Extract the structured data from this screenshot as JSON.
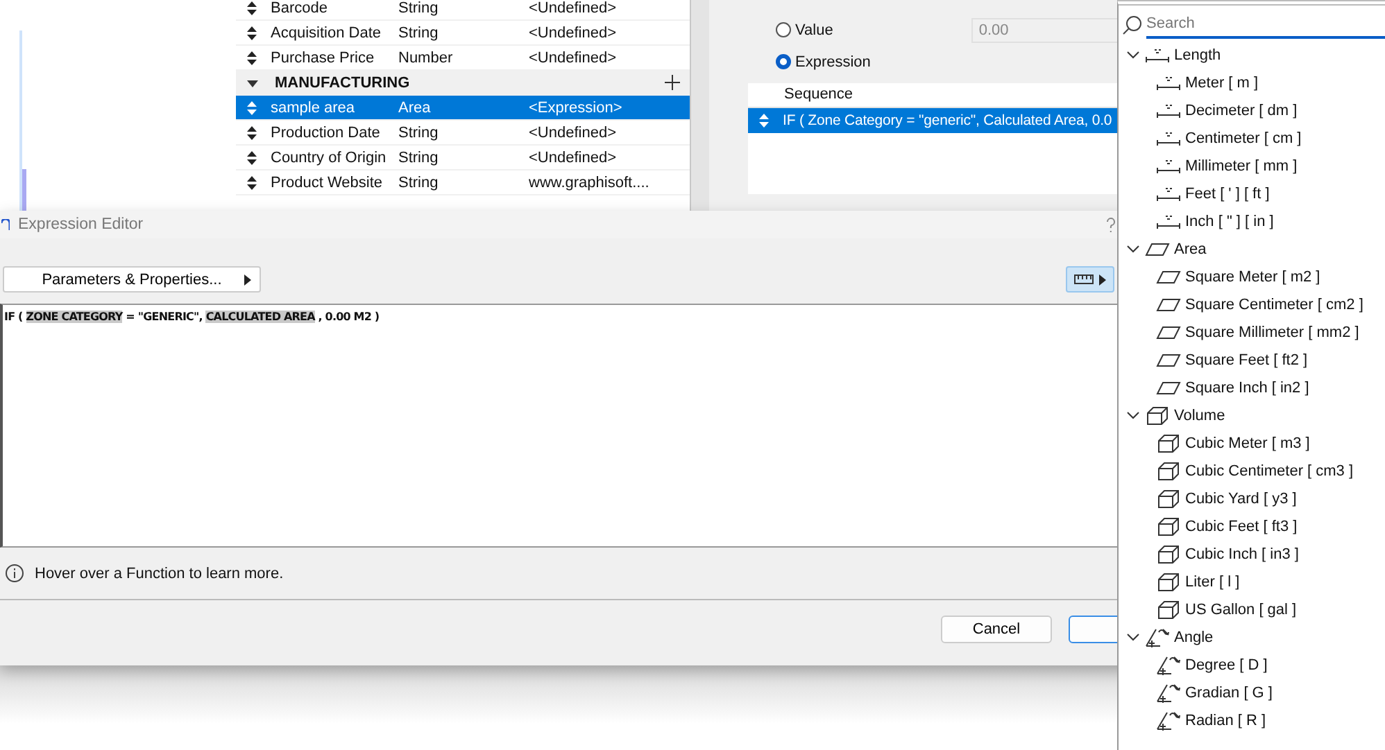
{
  "properties_table": {
    "rows": [
      {
        "kind": "property",
        "name": "Barcode",
        "type": "String",
        "value": "<Undefined>",
        "selected": false
      },
      {
        "kind": "property",
        "name": "Acquisition Date",
        "type": "String",
        "value": "<Undefined>",
        "selected": false
      },
      {
        "kind": "property",
        "name": "Purchase Price",
        "type": "Number",
        "value": "<Undefined>",
        "selected": false
      },
      {
        "kind": "group",
        "name": "MANUFACTURING",
        "expanded": true
      },
      {
        "kind": "property",
        "name": "sample area",
        "type": "Area",
        "value": "<Expression>",
        "selected": true
      },
      {
        "kind": "property",
        "name": "Production Date",
        "type": "String",
        "value": "<Undefined>",
        "selected": false
      },
      {
        "kind": "property",
        "name": "Country of Origin",
        "type": "String",
        "value": "<Undefined>",
        "selected": false
      },
      {
        "kind": "property",
        "name": "Product Website",
        "type": "String",
        "value": "www.graphisoft....",
        "selected": false
      }
    ]
  },
  "value_panel": {
    "options": [
      {
        "label": "Value",
        "selected": false,
        "value": "0.00",
        "disabled": true
      },
      {
        "label": "Expression",
        "selected": true
      }
    ],
    "sequence": {
      "header": "Sequence",
      "rows": [
        {
          "text": "IF ( Zone Category = \"generic\", Calculated Area, 0.0",
          "selected": true
        }
      ]
    }
  },
  "dialog": {
    "title": "Expression Editor",
    "parameters_button": "Parameters & Properties...",
    "expression": [
      {
        "kind": "text",
        "text": "IF ("
      },
      {
        "kind": "param",
        "text": "ZONE CATEGORY"
      },
      {
        "kind": "text",
        "text": "= \"GENERIC\","
      },
      {
        "kind": "param",
        "text": "CALCULATED AREA"
      },
      {
        "kind": "text",
        "text": ", 0.00 M2 )"
      }
    ],
    "hint": "Hover over a Function to learn more.",
    "buttons": [
      {
        "label": "Cancel",
        "default": false
      },
      {
        "default": true
      }
    ]
  },
  "units_menu": {
    "search": {
      "placeholder": "Search"
    },
    "categories": [
      {
        "kind": "length",
        "label": "Length",
        "expanded": true,
        "children": [
          {
            "label": "Meter [ m ]"
          },
          {
            "label": "Decimeter [ dm ]"
          },
          {
            "label": "Centimeter [ cm ]"
          },
          {
            "label": "Millimeter [ mm ]"
          },
          {
            "label": "Feet [ ' ] [ ft ]"
          },
          {
            "label": "Inch [ \" ] [ in ]"
          }
        ]
      },
      {
        "kind": "area",
        "label": "Area",
        "expanded": true,
        "children": [
          {
            "label": "Square Meter [ m2 ]"
          },
          {
            "label": "Square Centimeter [ cm2 ]"
          },
          {
            "label": "Square Millimeter [ mm2 ]"
          },
          {
            "label": "Square Feet [ ft2 ]"
          },
          {
            "label": "Square Inch [ in2 ]"
          }
        ]
      },
      {
        "kind": "volume",
        "label": "Volume",
        "expanded": true,
        "children": [
          {
            "label": "Cubic Meter [ m3 ]"
          },
          {
            "label": "Cubic Centimeter [ cm3 ]"
          },
          {
            "label": "Cubic Yard [ y3 ]"
          },
          {
            "label": "Cubic Feet [ ft3 ]"
          },
          {
            "label": "Cubic Inch [ in3 ]"
          },
          {
            "label": "Liter [ l ]"
          },
          {
            "label": "US Gallon [ gal ]"
          }
        ]
      },
      {
        "kind": "angle",
        "label": "Angle",
        "expanded": true,
        "children": [
          {
            "label": "Degree [ D ]"
          },
          {
            "label": "Gradian [ G ]"
          },
          {
            "label": "Radian [ R ]"
          }
        ]
      }
    ]
  }
}
